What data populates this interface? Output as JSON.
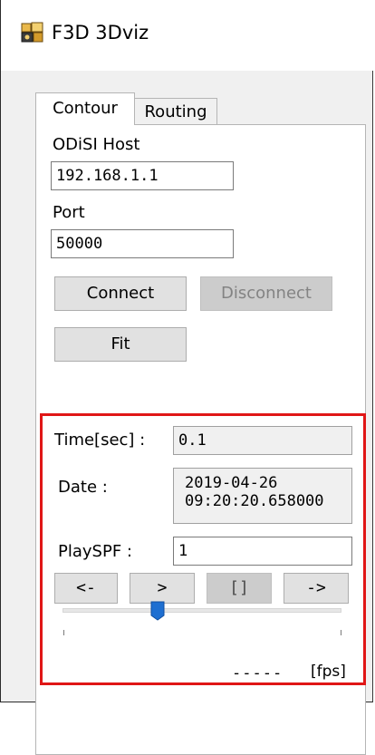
{
  "window": {
    "title": "F3D 3Dviz",
    "icon": "app-icon"
  },
  "tabs": [
    {
      "label": "Contour",
      "active": true
    },
    {
      "label": "Routing",
      "active": false
    }
  ],
  "connection": {
    "host_label": "ODiSI Host",
    "host_value": "192.168.1.1",
    "port_label": "Port",
    "port_value": "50000",
    "connect_label": "Connect",
    "disconnect_label": "Disconnect",
    "fit_label": "Fit"
  },
  "playback": {
    "time_label": "Time[sec] :",
    "time_value": "0.1",
    "date_label": "Date :",
    "date_line1": "2019-04-26",
    "date_line2": "09:20:20.658000",
    "playspf_label": "PlaySPF :",
    "playspf_value": "1",
    "buttons": {
      "prev": "<-",
      "play": ">",
      "stop": "[]",
      "next": "->"
    },
    "slider_position": 0.34
  },
  "status": {
    "fps_value": "-----",
    "fps_unit": "[fps]"
  },
  "colors": {
    "highlight_border": "#e01616",
    "slider_thumb": "#1e6fd1"
  }
}
